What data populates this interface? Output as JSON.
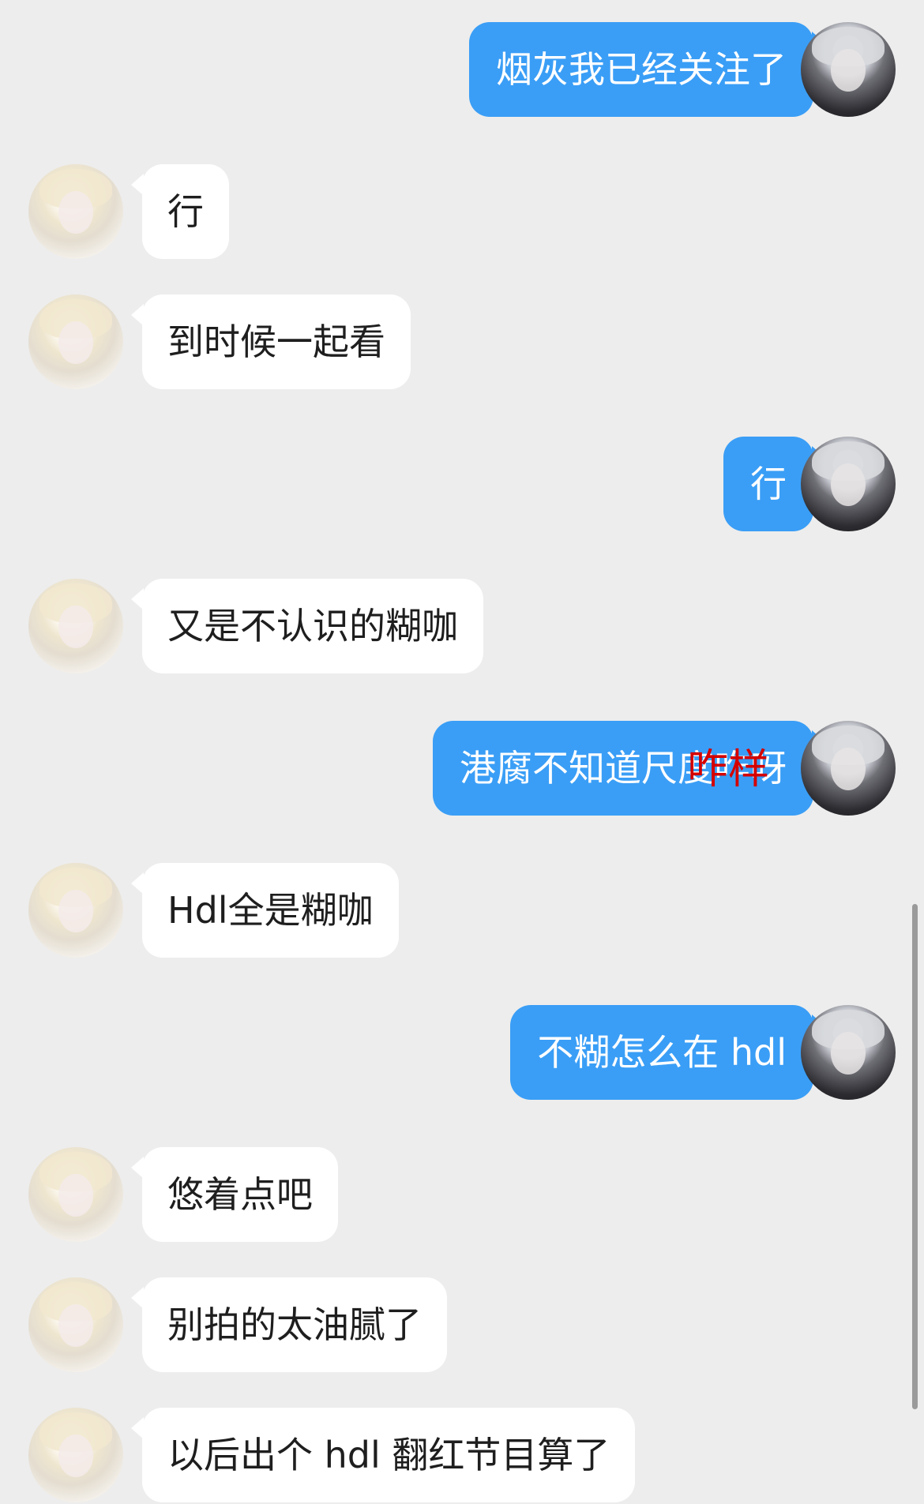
{
  "messages": [
    {
      "direction": "out",
      "text": "烟灰我已经关注了"
    },
    {
      "direction": "in",
      "text": "行"
    },
    {
      "direction": "in",
      "text": "到时候一起看"
    },
    {
      "direction": "out",
      "text": "行"
    },
    {
      "direction": "in",
      "text": "又是不认识的糊咖"
    },
    {
      "direction": "out",
      "text": "港腐不知道尺度咋呀"
    },
    {
      "direction": "in",
      "text": "Hdl全是糊咖"
    },
    {
      "direction": "out",
      "text": "不糊怎么在 hdl"
    },
    {
      "direction": "in",
      "text": "悠着点吧"
    },
    {
      "direction": "in",
      "text": "别拍的太油腻了"
    },
    {
      "direction": "in",
      "text": "以后出个 hdl 翻红节目算了"
    }
  ],
  "annotation": {
    "text": "咋样",
    "color": "#d40000"
  },
  "colors": {
    "background": "#ededed",
    "outgoing_bubble": "#3a9ef6",
    "incoming_bubble": "#ffffff"
  },
  "icons": {
    "outgoing_avatar": "silver-haired-character-avatar",
    "incoming_avatar": "blonde-character-avatar"
  }
}
